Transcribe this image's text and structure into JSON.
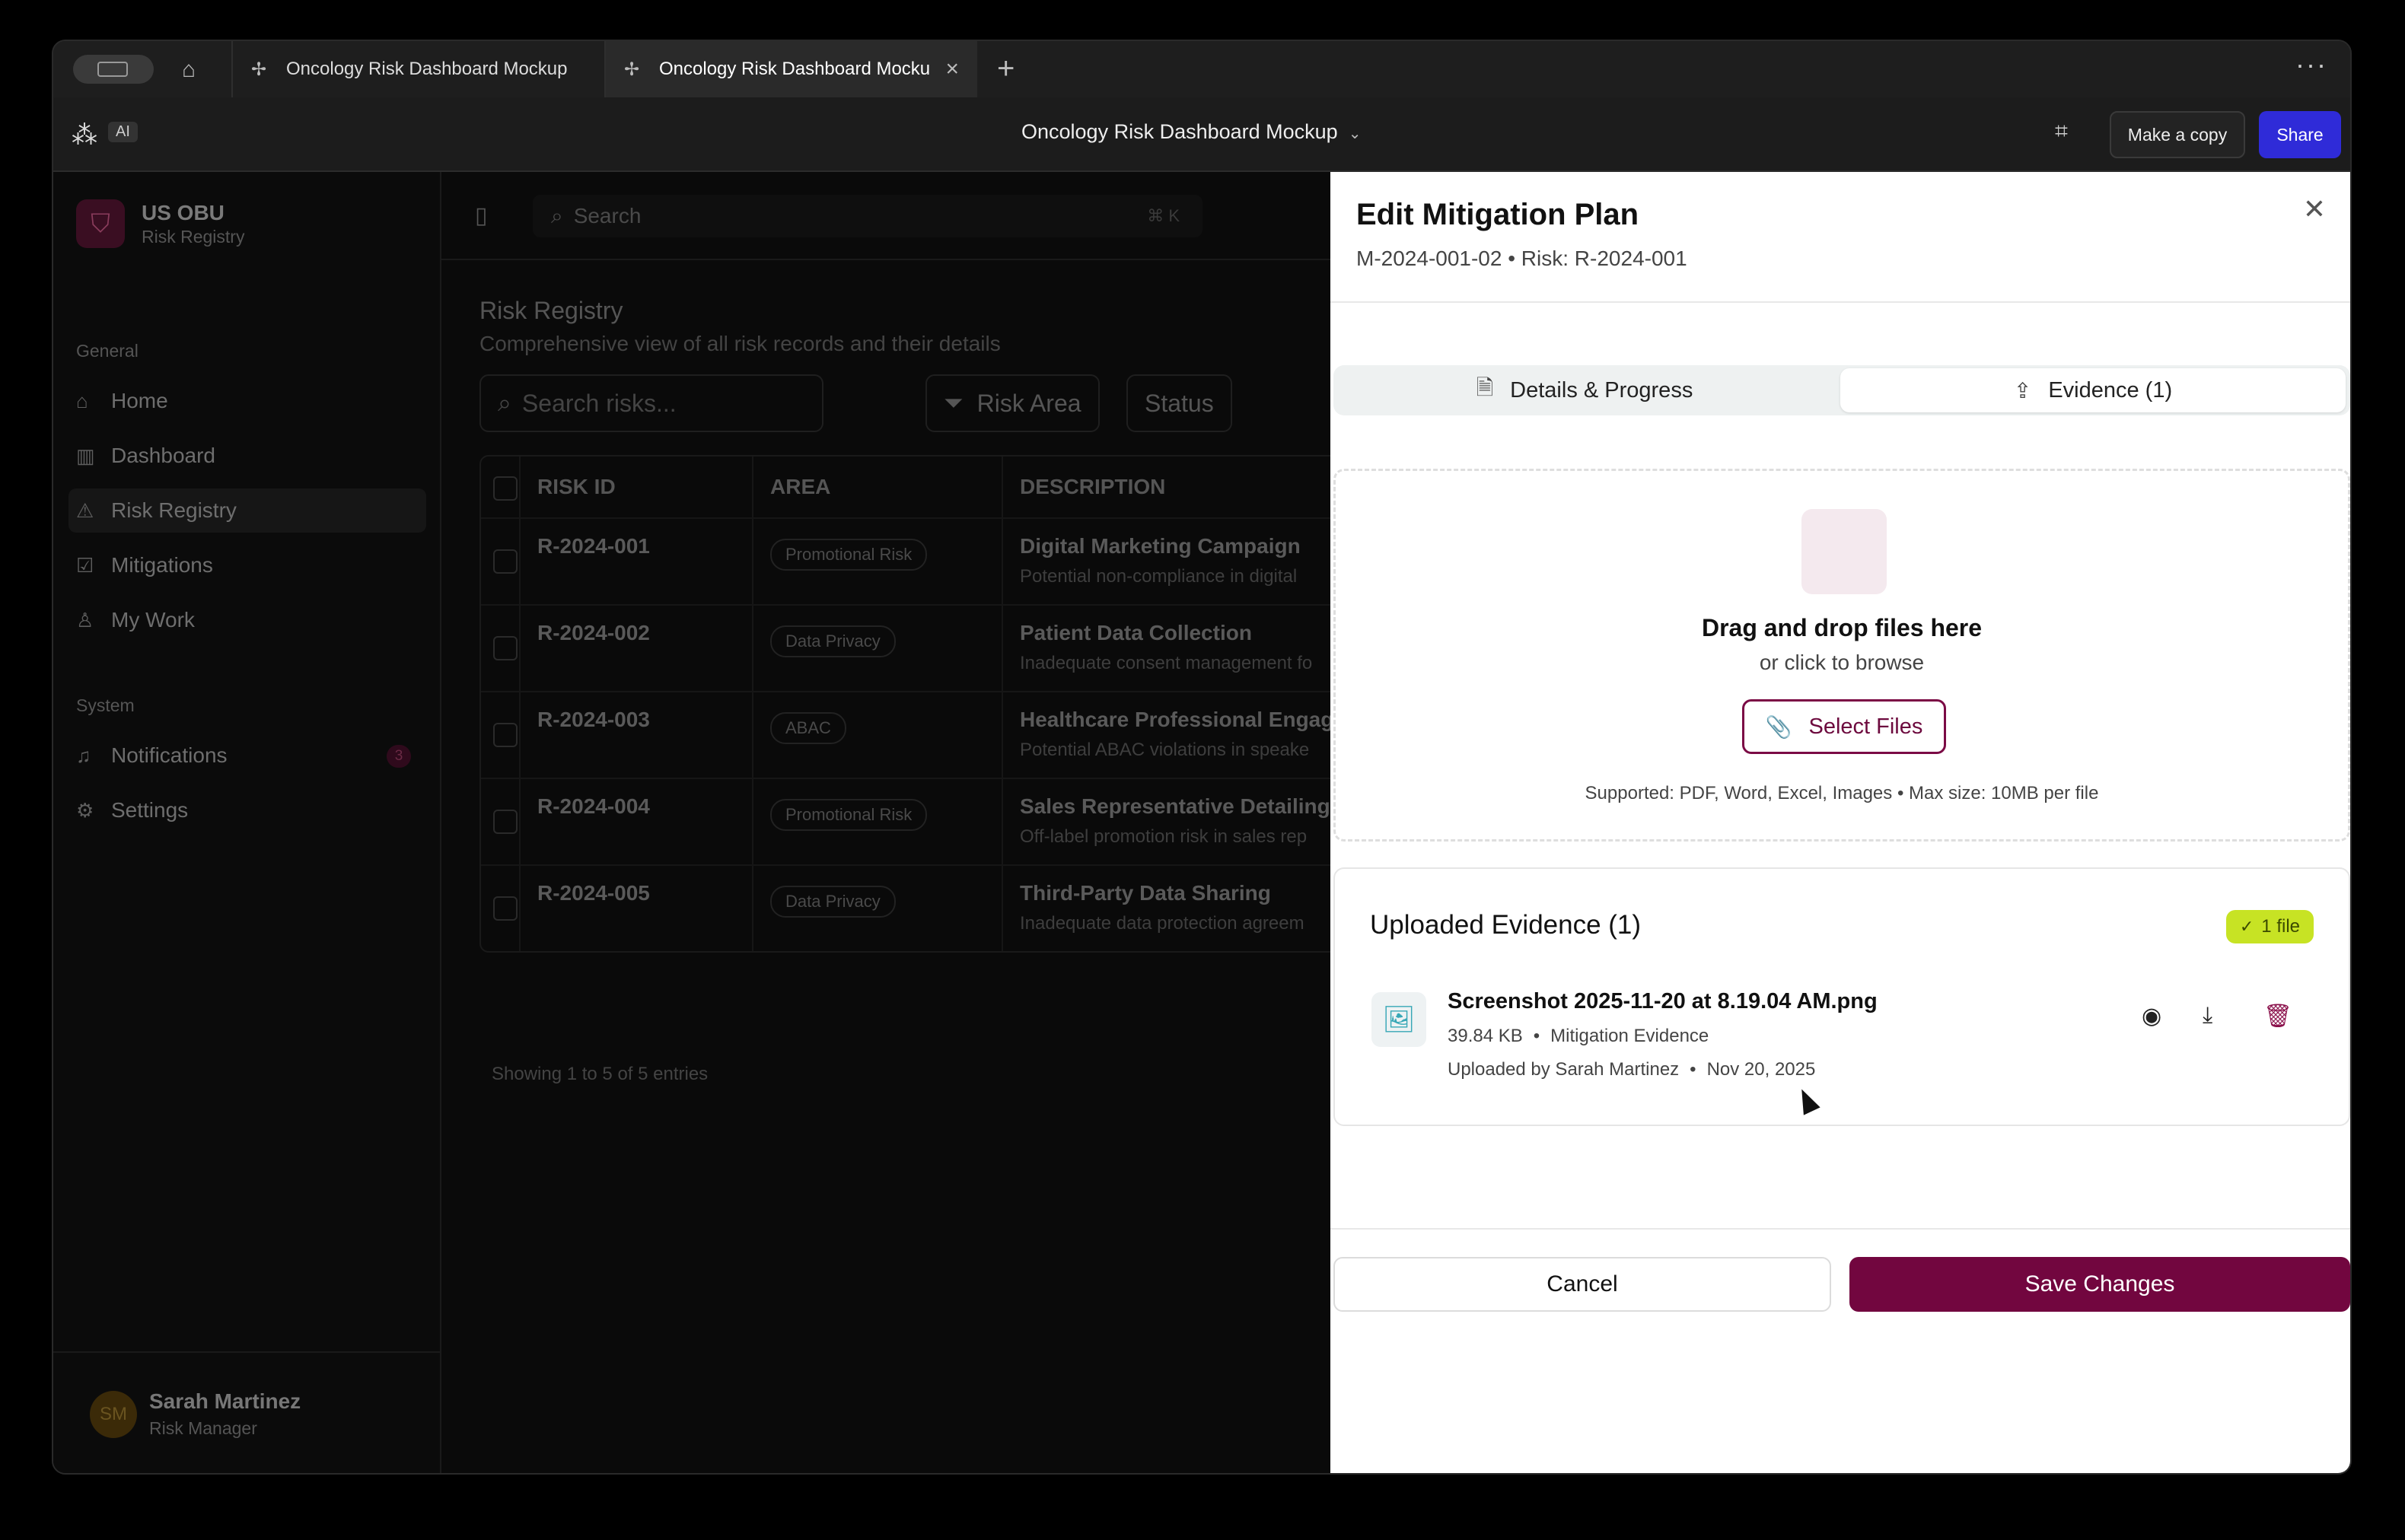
{
  "browser": {
    "tabs": [
      {
        "label": "Oncology Risk Dashboard Mockup"
      },
      {
        "label": "Oncology Risk Dashboard Mocku"
      }
    ]
  },
  "header": {
    "ai_label": "AI",
    "doc_title": "Oncology Risk Dashboard Mockup",
    "make_copy": "Make a copy",
    "share": "Share"
  },
  "sidebar": {
    "org": "US OBU",
    "org_sub": "Risk Registry",
    "sections": [
      {
        "title": "General",
        "items": [
          {
            "label": "Home",
            "icon": "home-icon"
          },
          {
            "label": "Dashboard",
            "icon": "bar-chart-icon"
          },
          {
            "label": "Risk Registry",
            "icon": "warning-icon"
          },
          {
            "label": "Mitigations",
            "icon": "checkbox-icon"
          },
          {
            "label": "My Work",
            "icon": "user-icon"
          }
        ]
      },
      {
        "title": "System",
        "items": [
          {
            "label": "Notifications",
            "icon": "bell-icon",
            "badge": "3"
          },
          {
            "label": "Settings",
            "icon": "gear-icon"
          }
        ]
      }
    ],
    "user": {
      "initials": "SM",
      "name": "Sarah Martinez",
      "role": "Risk Manager"
    }
  },
  "main": {
    "search_placeholder": "Search",
    "search_shortcut": "⌘ K",
    "title": "Risk Registry",
    "subtitle": "Comprehensive view of all risk records and their details",
    "risk_search_placeholder": "Search risks...",
    "filter_area": "Risk Area",
    "filter_status": "Status",
    "columns": [
      "RISK ID",
      "AREA",
      "DESCRIPTION"
    ],
    "rows": [
      {
        "id": "R-2024-001",
        "area": "Promotional Risk",
        "title": "Digital Marketing Campaign",
        "desc": "Potential non-compliance in digital"
      },
      {
        "id": "R-2024-002",
        "area": "Data Privacy",
        "title": "Patient Data Collection",
        "desc": "Inadequate consent management fo"
      },
      {
        "id": "R-2024-003",
        "area": "ABAC",
        "title": "Healthcare Professional Engag",
        "desc": "Potential ABAC violations in speake"
      },
      {
        "id": "R-2024-004",
        "area": "Promotional Risk",
        "title": "Sales Representative Detailing",
        "desc": "Off-label promotion risk in sales rep"
      },
      {
        "id": "R-2024-005",
        "area": "Data Privacy",
        "title": "Third-Party Data Sharing",
        "desc": "Inadequate data protection agreem"
      }
    ],
    "footer": "Showing 1 to 5 of 5 entries"
  },
  "drawer": {
    "title": "Edit Mitigation Plan",
    "subtitle": "M-2024-001-02 • Risk: R-2024-001",
    "tabs": {
      "details": "Details & Progress",
      "evidence": "Evidence (1)"
    },
    "dropzone": {
      "main": "Drag and drop files here",
      "alt": "or click to browse",
      "button": "Select Files",
      "note": "Supported: PDF, Word, Excel, Images • Max size: 10MB per file"
    },
    "evidence": {
      "title": "Uploaded Evidence (1)",
      "badge": "1 file",
      "file": {
        "name": "Screenshot 2025-11-20 at 8.19.04 AM.png",
        "size": "39.84 KB",
        "category": "Mitigation Evidence",
        "uploaded_by": "Uploaded by Sarah Martinez",
        "date": "Nov 20, 2025"
      }
    },
    "cancel": "Cancel",
    "save": "Save Changes"
  },
  "colors": {
    "accent": "#72063f",
    "share": "#2f2bd8",
    "badge": "#c7e324"
  }
}
